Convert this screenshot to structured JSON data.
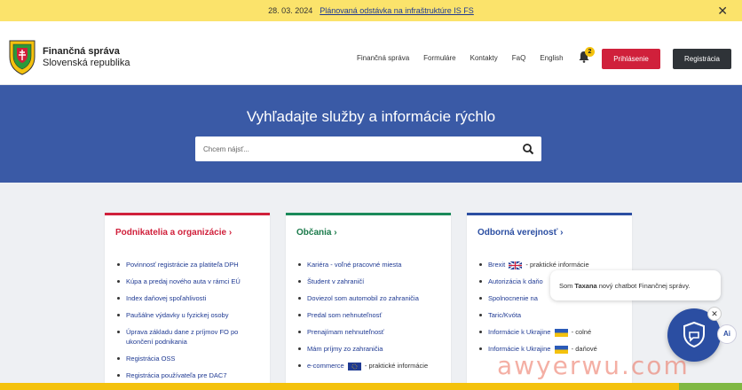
{
  "notice": {
    "date": "28. 03. 2024",
    "text": "Plánovaná odstávka na infraštruktúre IS FS",
    "close": "✕"
  },
  "header": {
    "brand_line1": "Finančná správa",
    "brand_line2": "Slovenská republika",
    "nav": [
      "Finančná správa",
      "Formuláre",
      "Kontakty",
      "FaQ",
      "English"
    ],
    "notification_count": "2",
    "login_label": "Prihlásenie",
    "register_label": "Registrácia"
  },
  "hero": {
    "title": "Vyhľadajte služby a informácie rýchlo",
    "search_placeholder": "Chcem nájsť..."
  },
  "cards": [
    {
      "title": "Podnikatelia a organizácie",
      "items": [
        "Povinnosť registrácie za platiteľa DPH",
        "Kúpa a predaj nového auta v rámci EÚ",
        "Index daňovej spoľahlivosti",
        "Paušálne výdavky u fyzickej osoby",
        "Úprava základu dane z príjmov FO po ukončení podnikania",
        "Registrácia OSS",
        "Registrácia používateľa pre DAC7"
      ]
    },
    {
      "title": "Občania",
      "items": [
        "Kariéra - voľné pracovné miesta",
        "Študent v zahraničí",
        "Doviezol som automobil zo zahraničia",
        "Predal som nehnuteľnosť",
        "Prenajímam nehnuteľnosť",
        "Mám príjmy zo zahraničia",
        "e-commerce",
        "- praktické informácie"
      ]
    },
    {
      "title": "Odborná verejnosť",
      "items": [
        "Brexit",
        "- praktické informácie",
        "Autorizácia k daňo",
        "Spolnocnenie na",
        "Taric/Kvóta",
        "Informácie k Ukrajine",
        "- colné",
        "Informácie k Ukrajine",
        "- daňové"
      ]
    }
  ],
  "chatbot": {
    "text_before": "Som",
    "name": "Taxana",
    "text_after": "nový chatbot Finančnej správy.",
    "close": "✕",
    "ai_label": "Ai"
  },
  "colors": {
    "notice_bg": "#fbe36b",
    "hero_bg": "#3a5aa6",
    "login_bg": "#d0203b",
    "register_bg": "#2f3338"
  },
  "watermark": "awyerwu.com"
}
